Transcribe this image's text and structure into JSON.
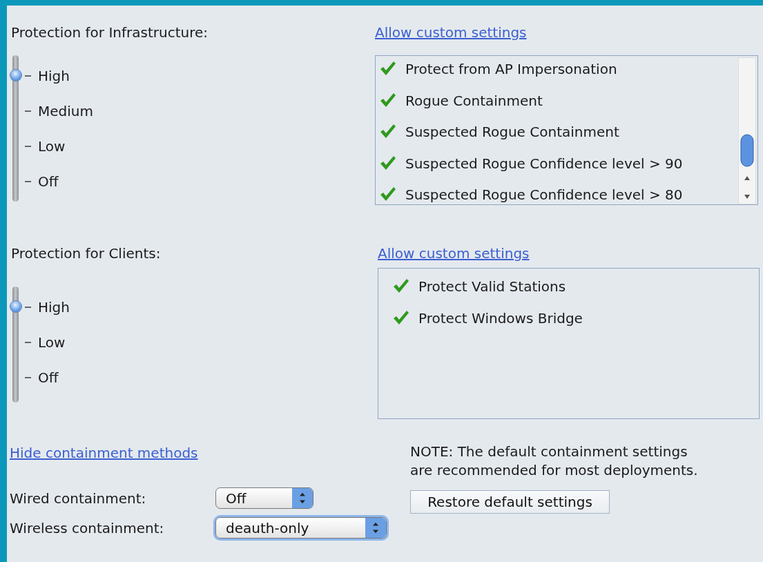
{
  "infrastructure": {
    "label": "Protection for Infrastructure:",
    "link": "Allow custom settings",
    "levels": [
      {
        "label": "High",
        "selected": true
      },
      {
        "label": "Medium",
        "selected": false
      },
      {
        "label": "Low",
        "selected": false
      },
      {
        "label": "Off",
        "selected": false
      }
    ],
    "settings": [
      {
        "label": "Protect from AP Impersonation",
        "checked": true
      },
      {
        "label": "Rogue Containment",
        "checked": true
      },
      {
        "label": "Suspected Rogue Containment",
        "checked": true
      },
      {
        "label": "Suspected Rogue Confidence level > 90",
        "checked": true
      },
      {
        "label": "Suspected Rogue Confidence level > 80",
        "checked": true
      }
    ]
  },
  "clients": {
    "label": "Protection for Clients:",
    "link": "Allow custom settings",
    "levels": [
      {
        "label": "High",
        "selected": true
      },
      {
        "label": "Low",
        "selected": false
      },
      {
        "label": "Off",
        "selected": false
      }
    ],
    "settings": [
      {
        "label": "Protect Valid Stations",
        "checked": true
      },
      {
        "label": "Protect Windows Bridge",
        "checked": true
      }
    ]
  },
  "containment": {
    "link": "Hide containment methods",
    "fields": [
      {
        "label": "Wired containment:",
        "value": "Off",
        "focused": false
      },
      {
        "label": "Wireless containment:",
        "value": "deauth-only",
        "focused": true
      }
    ],
    "note": [
      "NOTE: The default containment settings",
      "are recommended for most deployments."
    ],
    "button": "Restore default settings"
  }
}
